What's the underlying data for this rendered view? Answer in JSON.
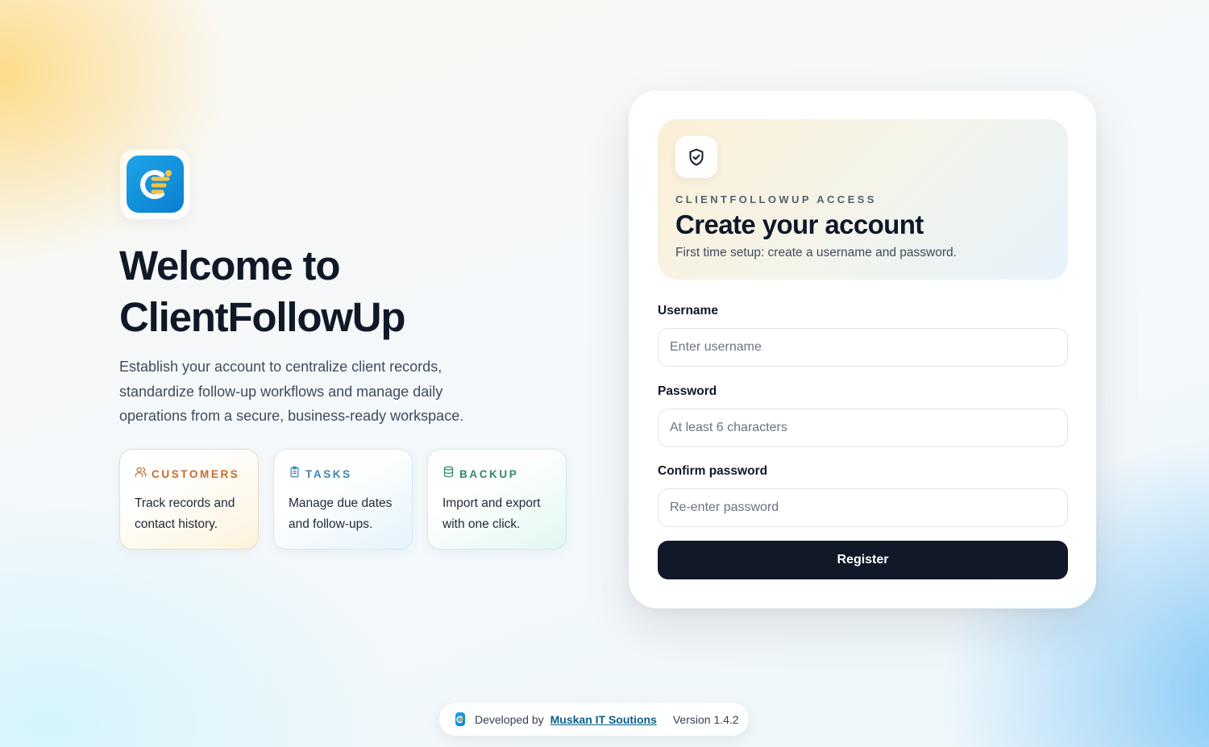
{
  "hero": {
    "title_line1": "Welcome to",
    "title_line2": "ClientFollowUp",
    "description": "Establish your account to centralize client records, standardize follow-up workflows and manage daily operations from a secure, business-ready workspace."
  },
  "features": [
    {
      "title": "CUSTOMERS",
      "description": "Track records and contact history.",
      "icon": "users-icon"
    },
    {
      "title": "TASKS",
      "description": "Manage due dates and follow-ups.",
      "icon": "clipboard-icon"
    },
    {
      "title": "BACKUP",
      "description": "Import and export with one click.",
      "icon": "database-icon"
    }
  ],
  "card": {
    "eyebrow": "CLIENTFOLLOWUP ACCESS",
    "title": "Create your account",
    "subtitle": "First time setup: create a username and password.",
    "username": {
      "label": "Username",
      "placeholder": "Enter username",
      "value": ""
    },
    "password": {
      "label": "Password",
      "placeholder": "At least 6 characters",
      "value": ""
    },
    "confirm": {
      "label": "Confirm password",
      "placeholder": "Re-enter password",
      "value": ""
    },
    "submit_label": "Register"
  },
  "footer": {
    "developed_by": "Developed by",
    "company": "Muskan IT Soutions",
    "version": "Version 1.4.2"
  },
  "colors": {
    "brand_blue": "#1ea5e8",
    "logo_accent": "#f6c343",
    "primary_button": "#111827",
    "customers_accent": "#c46c2a",
    "tasks_accent": "#3a86b8",
    "backup_accent": "#2f8a62"
  }
}
